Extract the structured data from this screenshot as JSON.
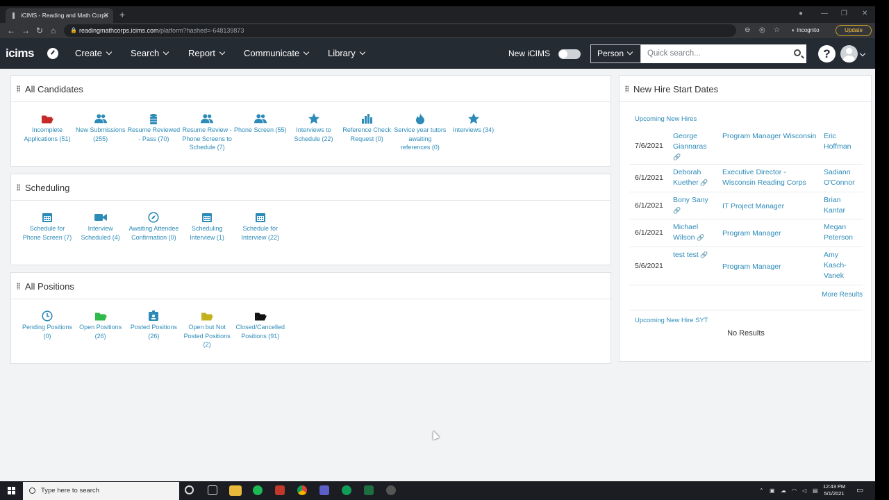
{
  "browser": {
    "tab_title": "iCIMS - Reading and Math Corps",
    "new_tab": "+",
    "url_host": "readingmathcorps.icims.com",
    "url_path": "/platform?hashed=-648139873",
    "incognito_label": "Incognito",
    "update_label": "Update"
  },
  "header": {
    "logo": "icims",
    "nav": [
      {
        "label": "Create"
      },
      {
        "label": "Search"
      },
      {
        "label": "Report"
      },
      {
        "label": "Communicate"
      },
      {
        "label": "Library"
      }
    ],
    "new_icims_label": "New iCIMS",
    "search_scope": "Person",
    "search_placeholder": "Quick search...",
    "help": "?"
  },
  "all_candidates": {
    "title": "All Candidates",
    "tiles": [
      {
        "icon": "folder-open-icon",
        "color": "#c62828",
        "label": "Incomplete Applications (51)"
      },
      {
        "icon": "users-icon",
        "color": "#2d8bb8",
        "label": "New Submissions (255)"
      },
      {
        "icon": "database-icon",
        "color": "#2d8bb8",
        "label": "Resume Reviewed - Pass (70)"
      },
      {
        "icon": "users-icon",
        "color": "#2d8bb8",
        "label": "Resume Review - Phone Screens to Schedule (7)"
      },
      {
        "icon": "users-icon",
        "color": "#2d8bb8",
        "label": "Phone Screen (55)"
      },
      {
        "icon": "star-icon",
        "color": "#2d8bb8",
        "label": "Interviews to Schedule (22)"
      },
      {
        "icon": "bar-chart-icon",
        "color": "#2d8bb8",
        "label": "Reference Check Request (0)"
      },
      {
        "icon": "fire-icon",
        "color": "#2d8bb8",
        "label": "Service year tutors awaiting references (0)"
      },
      {
        "icon": "star-icon",
        "color": "#2d8bb8",
        "label": "Interviews (34)"
      }
    ]
  },
  "scheduling": {
    "title": "Scheduling",
    "tiles": [
      {
        "icon": "calendar-icon",
        "color": "#2d8bb8",
        "label": "Schedule for Phone Screen (7)"
      },
      {
        "icon": "video-camera-icon",
        "color": "#2d8bb8",
        "label": "Interview Scheduled (4)"
      },
      {
        "icon": "compass-icon",
        "color": "#2d8bb8",
        "label": "Awaiting Attendee Confirmation (0)"
      },
      {
        "icon": "calendar-icon",
        "color": "#2d8bb8",
        "label": "Scheduling Interview (1)"
      },
      {
        "icon": "calendar-icon",
        "color": "#2d8bb8",
        "label": "Schedule for Interview (22)"
      }
    ]
  },
  "all_positions": {
    "title": "All Positions",
    "tiles": [
      {
        "icon": "clock-icon",
        "color": "#2d8bb8",
        "label": "Pending Positions (0)"
      },
      {
        "icon": "folder-open-icon",
        "color": "#2fb84a",
        "label": "Open Positions (26)"
      },
      {
        "icon": "id-card-icon",
        "color": "#2d8bb8",
        "label": "Posted Positions (26)"
      },
      {
        "icon": "folder-open-icon",
        "color": "#c3b21d",
        "label": "Open but Not Posted Positions (2)"
      },
      {
        "icon": "folder-open-icon",
        "color": "#111111",
        "label": "Closed/Cancelled Positions (91)"
      }
    ]
  },
  "new_hire": {
    "title": "New Hire Start Dates",
    "upcoming_label": "Upcoming New Hires",
    "rows": [
      {
        "date": "7/6/2021",
        "name": "George Giannaras",
        "job": "Program Manager Wisconsin",
        "manager": "Eric Hoffman"
      },
      {
        "date": "6/1/2021",
        "name": "Deborah Kuether",
        "job": "Executive Director - Wisconsin Reading Corps",
        "manager": "Sadiann O'Connor"
      },
      {
        "date": "6/1/2021",
        "name": "Bony Sany",
        "job": "IT Project Manager",
        "manager": "Brian Kantar"
      },
      {
        "date": "6/1/2021",
        "name": "Michael Wilson",
        "job": "Program Manager",
        "manager": "Megan Peterson"
      },
      {
        "date": "5/6/2021",
        "name": "test test",
        "job": "Program Manager",
        "manager": "Amy Kasch-Vanek"
      }
    ],
    "more_results": "More Results",
    "syt_label": "Upcoming New Hire SYT",
    "no_results": "No Results"
  },
  "taskbar": {
    "search_placeholder": "Type here to search",
    "time": "12:43 PM",
    "date": "5/1/2021"
  }
}
